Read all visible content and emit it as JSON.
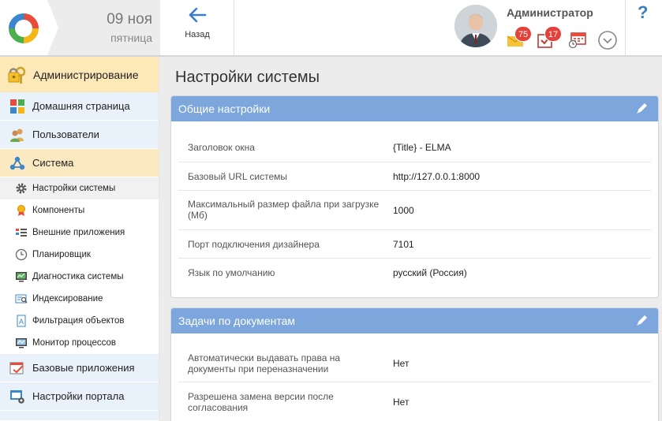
{
  "header": {
    "date_day": "09 ноя",
    "weekday": "пятница",
    "back_label": "Назад",
    "user_name": "Администратор",
    "messages_count": "75",
    "tasks_count": "17",
    "help_label": "?"
  },
  "sidebar": {
    "sections": [
      {
        "label": "Администрирование",
        "icon": "lock-keys-icon"
      },
      {
        "label": "Домашняя страница",
        "icon": "tiles-icon"
      },
      {
        "label": "Пользователи",
        "icon": "users-icon"
      },
      {
        "label": "Система",
        "icon": "system-nodes-icon"
      }
    ],
    "subitems": [
      {
        "label": "Настройки системы",
        "icon": "gear-icon"
      },
      {
        "label": "Компоненты",
        "icon": "medal-icon"
      },
      {
        "label": "Внешние приложения",
        "icon": "external-apps-icon"
      },
      {
        "label": "Планировщик",
        "icon": "clock-icon"
      },
      {
        "label": "Диагностика системы",
        "icon": "monitor-icon"
      },
      {
        "label": "Индексирование",
        "icon": "index-icon"
      },
      {
        "label": "Фильтрация объектов",
        "icon": "filter-doc-icon"
      },
      {
        "label": "Монитор процессов",
        "icon": "process-monitor-icon"
      }
    ],
    "bottom_sections": [
      {
        "label": "Базовые приложения",
        "icon": "base-apps-icon"
      },
      {
        "label": "Настройки портала",
        "icon": "portal-settings-icon"
      }
    ]
  },
  "main": {
    "title": "Настройки системы",
    "general": {
      "title": "Общие настройки",
      "rows": [
        {
          "label": "Заголовок окна",
          "value": "{Title} - ELMA"
        },
        {
          "label": "Базовый URL системы",
          "value": "http://127.0.0.1:8000"
        },
        {
          "label": "Максимальный размер файла при загрузке (Мб)",
          "value": "1000"
        },
        {
          "label": "Порт подключения дизайнера",
          "value": "7101"
        },
        {
          "label": "Язык по умолчанию",
          "value": "русский (Россия)"
        }
      ]
    },
    "doc_tasks": {
      "title": "Задачи по документам",
      "rows": [
        {
          "label": "Автоматически выдавать права на документы при переназначении",
          "value": "Нет"
        },
        {
          "label": "Разрешена замена версии после согласования",
          "value": "Нет"
        }
      ]
    }
  },
  "colors": {
    "card_header": "#7ca6dc",
    "admin_section": "#fde8b8",
    "nav_item": "#e9f1fa",
    "badge": "#e3413a",
    "accent": "#3b7ec7"
  }
}
